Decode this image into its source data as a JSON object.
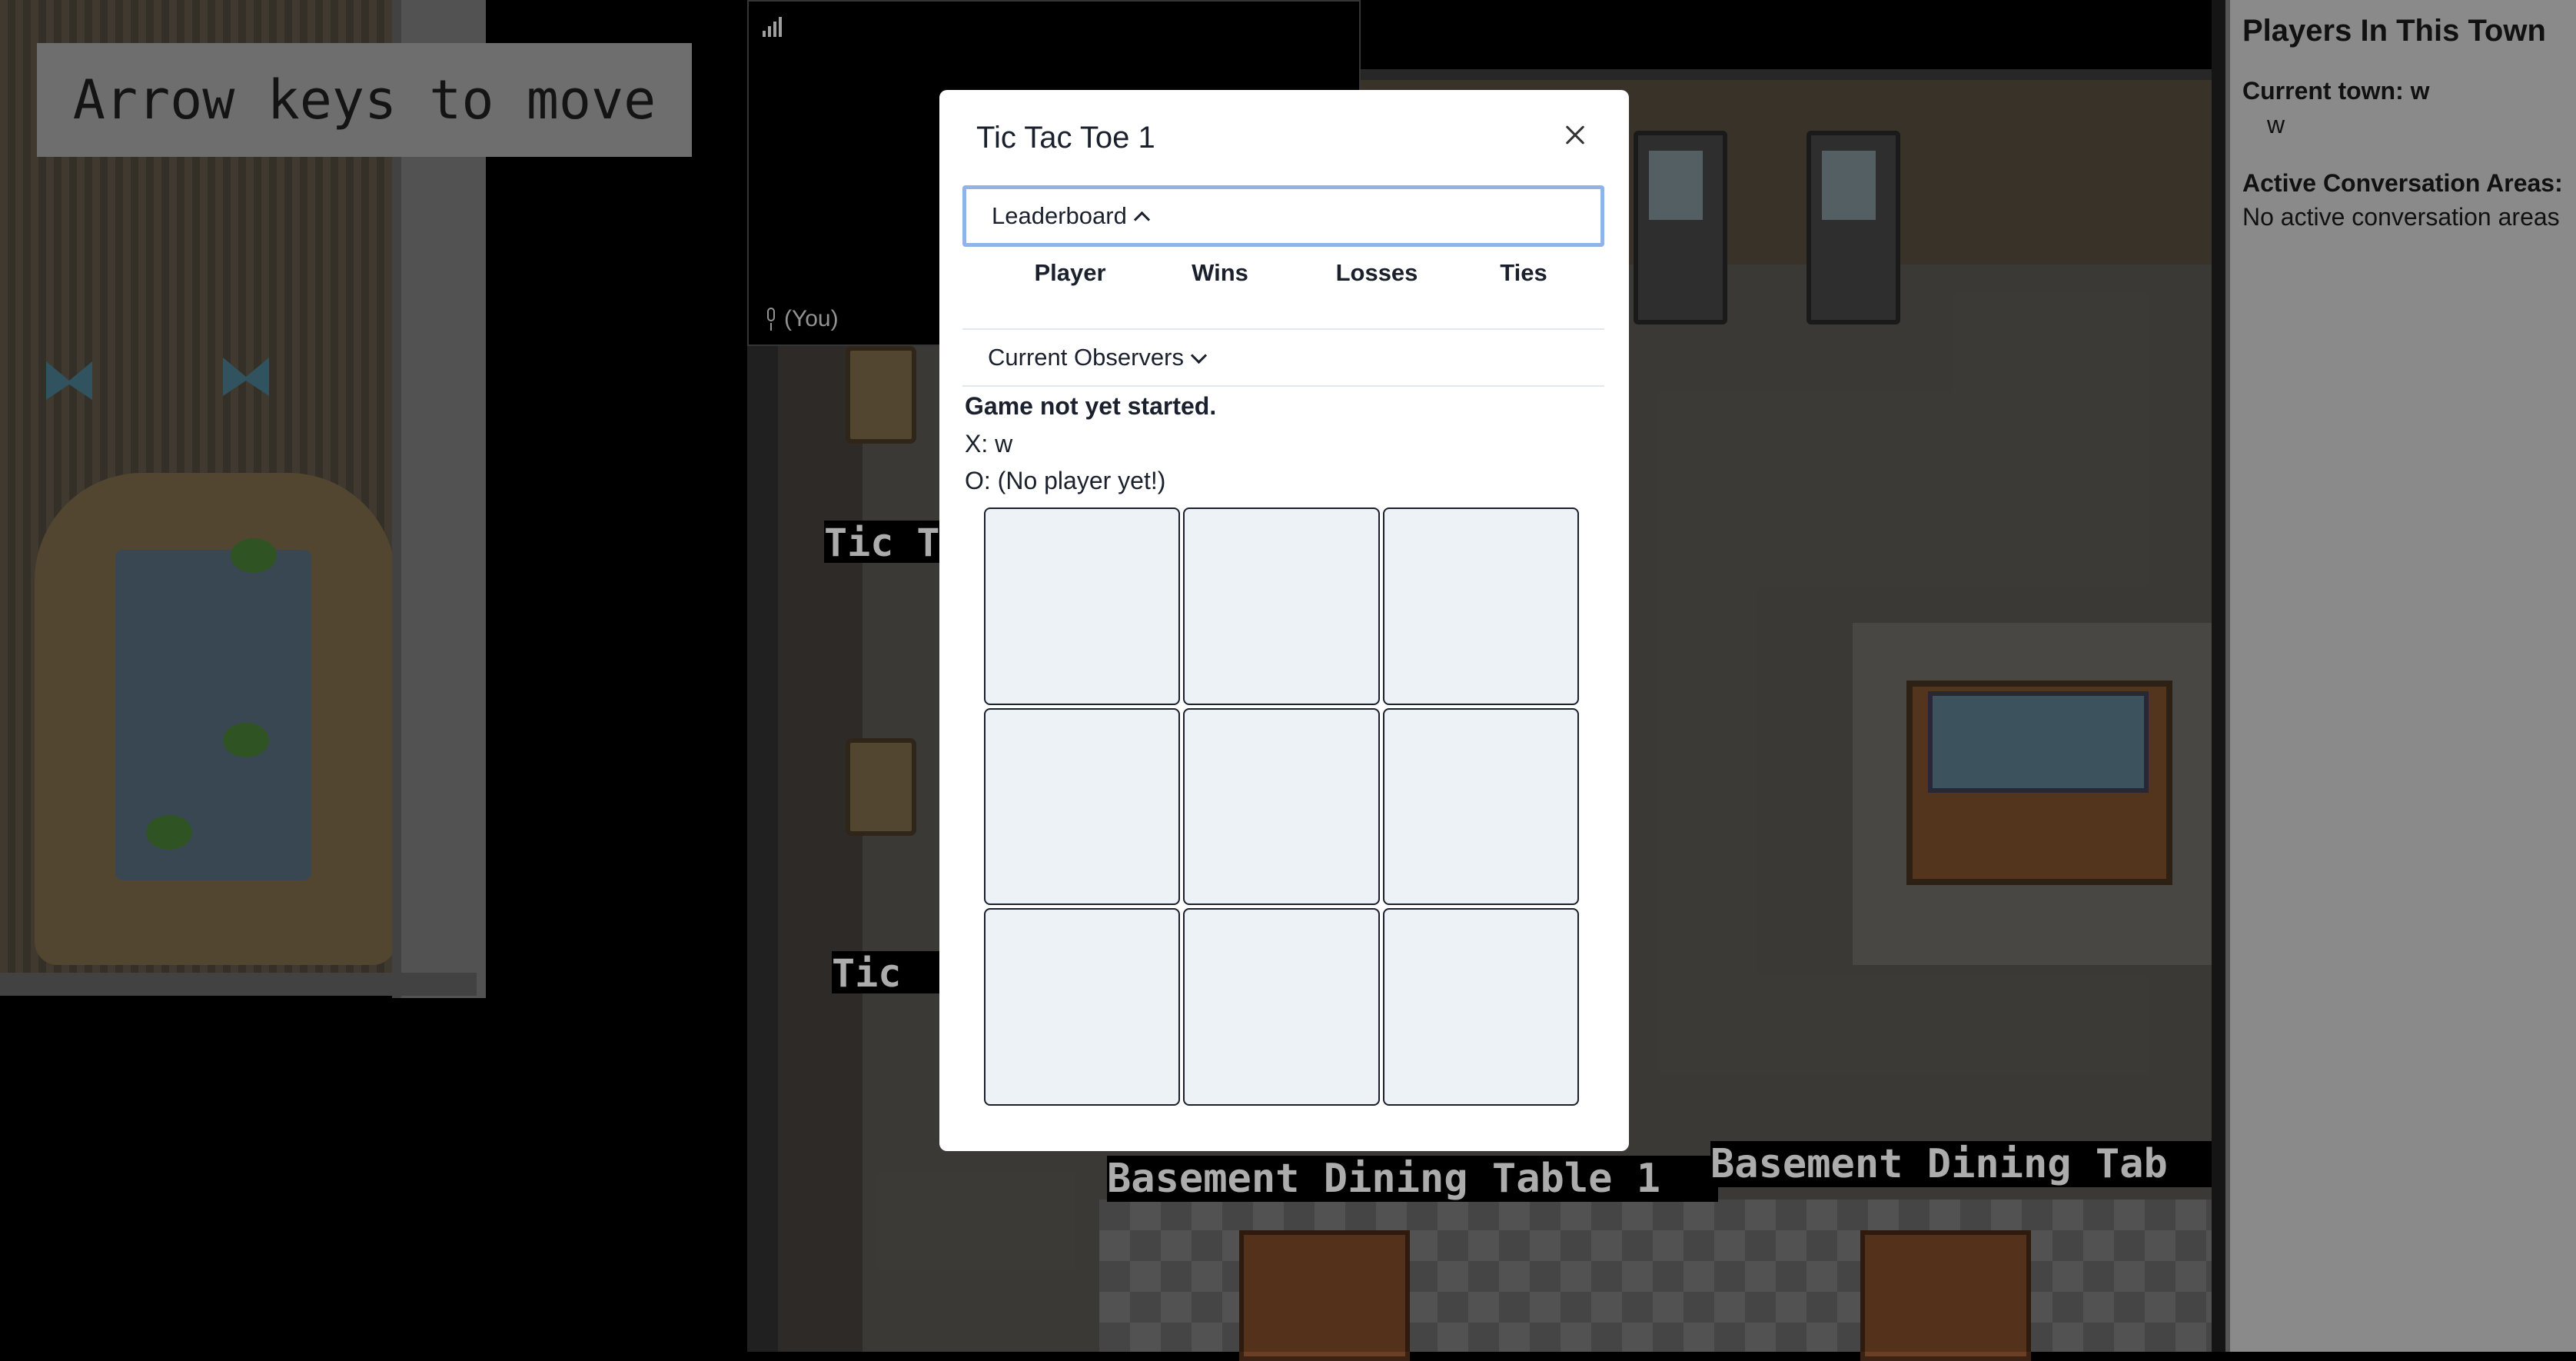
{
  "hint": {
    "text": "Arrow keys to move"
  },
  "map_signs": {
    "tic_1": "Tic T",
    "tic_2": "Tic",
    "dining_1": "Basement Dining Table 1",
    "dining_2": "Basement Dining Tab"
  },
  "video": {
    "self_label": "(You)"
  },
  "modal": {
    "title": "Tic Tac Toe 1",
    "leaderboard_label": "Leaderboard",
    "leaderboard_columns": [
      "Player",
      "Wins",
      "Losses",
      "Ties"
    ],
    "observers_label": "Current Observers",
    "status": "Game not yet started.",
    "player_x": "X: w",
    "player_o": "O: (No player yet!)",
    "board": [
      "",
      "",
      "",
      "",
      "",
      "",
      "",
      "",
      ""
    ]
  },
  "side_panel": {
    "title": "Players In This Town",
    "current_town": "Current town: w",
    "players": [
      "w"
    ],
    "conversation_heading": "Active Conversation Areas:",
    "conversation_empty": "No active conversation areas"
  }
}
